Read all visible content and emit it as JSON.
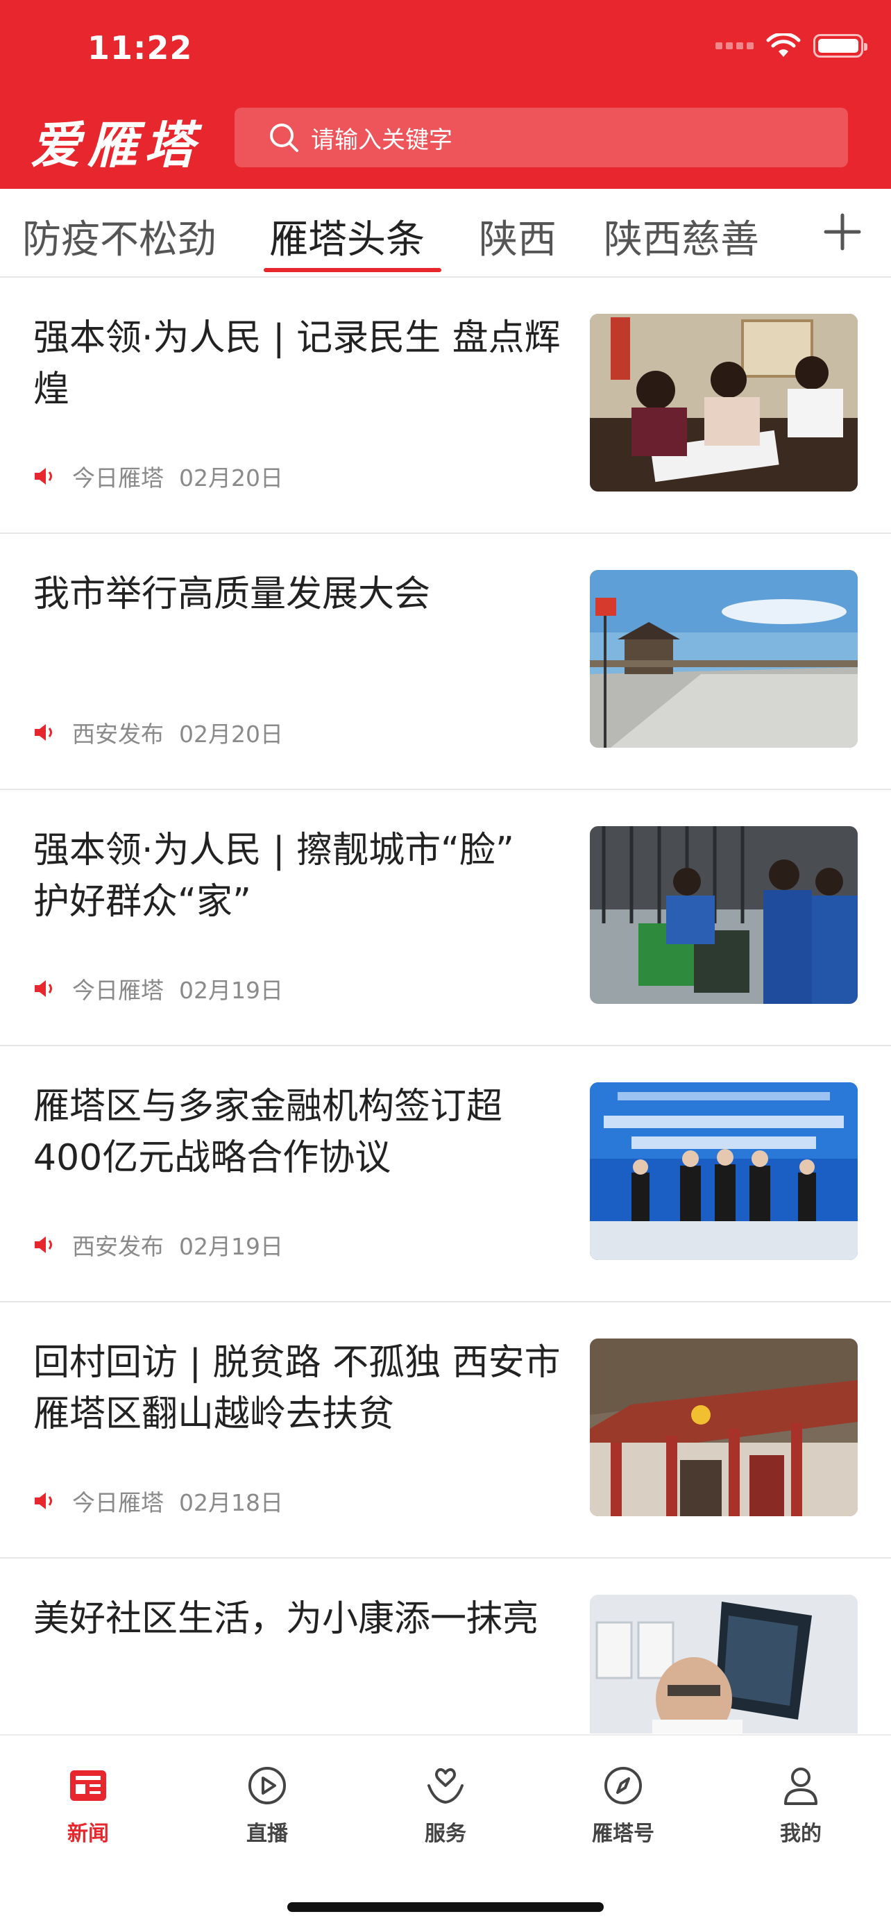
{
  "status_bar": {
    "time": "11:22"
  },
  "header": {
    "logo_text": "爱雁塔",
    "search_placeholder": "请输入关键字",
    "accent_color": "#e8262d"
  },
  "tabs": [
    {
      "label": "防疫不松劲",
      "active": false
    },
    {
      "label": "雁塔头条",
      "active": true
    },
    {
      "label": "陕西",
      "active": false
    },
    {
      "label": "陕西慈善",
      "active": false
    }
  ],
  "tab_add_icon": "plus-icon",
  "news": [
    {
      "title": "强本领·为人民 | 记录民生 盘点辉煌",
      "source": "今日雁塔",
      "date": "02月20日",
      "thumb": "meeting-photo"
    },
    {
      "title": "我市举行高质量发展大会",
      "source": "西安发布",
      "date": "02月20日",
      "thumb": "city-wall-photo"
    },
    {
      "title": "强本领·为人民 | 擦靓城市“脸” 护好群众“家”",
      "source": "今日雁塔",
      "date": "02月19日",
      "thumb": "sanitation-photo"
    },
    {
      "title": "雁塔区与多家金融机构签订超400亿元战略合作协议",
      "source": "西安发布",
      "date": "02月19日",
      "thumb": "signing-ceremony-photo"
    },
    {
      "title": "回村回访 | 脱贫路 不孤独 西安市雁塔区翻山越岭去扶贫",
      "source": "今日雁塔",
      "date": "02月18日",
      "thumb": "village-building-photo"
    },
    {
      "title": "美好社区生活，为小康添一抹亮",
      "source": "",
      "date": "",
      "thumb": "xray-doctor-photo"
    }
  ],
  "bottom_nav": [
    {
      "label": "新闻",
      "icon": "news-icon",
      "active": true
    },
    {
      "label": "直播",
      "icon": "play-icon",
      "active": false
    },
    {
      "label": "服务",
      "icon": "service-heart-icon",
      "active": false
    },
    {
      "label": "雁塔号",
      "icon": "compass-icon",
      "active": false
    },
    {
      "label": "我的",
      "icon": "user-icon",
      "active": false
    }
  ]
}
